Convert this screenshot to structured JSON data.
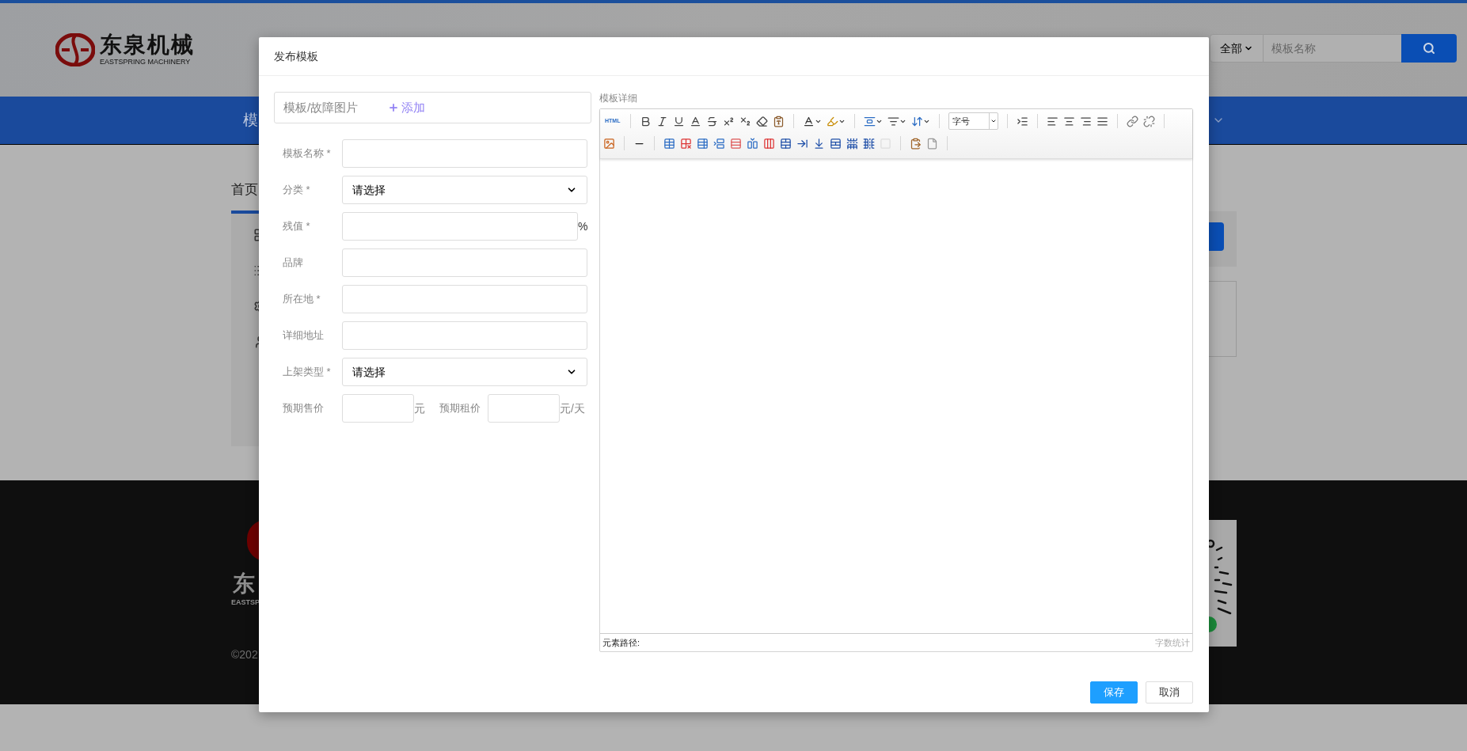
{
  "header": {
    "logo": {
      "name": "东泉机械",
      "subtitle": "EASTSPRING MACHINERY"
    },
    "search": {
      "scope": "全部",
      "placeholder": "模板名称"
    }
  },
  "nav": {
    "items": [
      "模"
    ]
  },
  "breadcrumb": "首页",
  "footer": {
    "logo_text": "东",
    "logo_subtitle": "EASTSP",
    "copyright": "©202"
  },
  "dialog": {
    "title": "发布模板",
    "upload": {
      "label": "模板/故障图片",
      "add": "添加"
    },
    "fields": [
      {
        "kind": "text",
        "label": "模板名称 *"
      },
      {
        "kind": "select",
        "label": "分类 *",
        "value": "请选择"
      },
      {
        "kind": "text",
        "label": "残值 *",
        "suffix": "%"
      },
      {
        "kind": "text",
        "label": "品牌"
      },
      {
        "kind": "text",
        "label": "所在地 *"
      },
      {
        "kind": "text",
        "label": "详细地址"
      },
      {
        "kind": "select",
        "label": "上架类型 *",
        "value": "请选择"
      }
    ],
    "price_row": [
      {
        "label": "预期售价",
        "unit": "元"
      },
      {
        "label": "预期租价",
        "unit": "元/天"
      }
    ],
    "editor": {
      "label": "模板详细",
      "html_button": "HTML",
      "font_size": "字号",
      "path_label": "元素路径:",
      "word_count": "字数统计"
    },
    "buttons": [
      {
        "kind": "primary",
        "label": "保存"
      },
      {
        "kind": "default",
        "label": "取消"
      }
    ]
  }
}
